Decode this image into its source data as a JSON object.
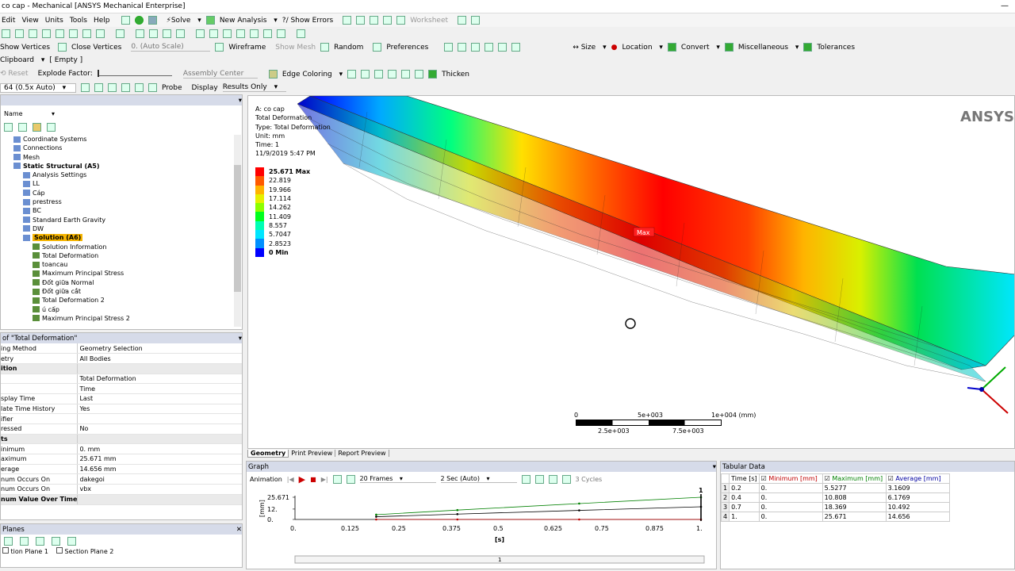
{
  "window": {
    "title": "co cap - Mechanical [ANSYS Mechanical Enterprise]"
  },
  "menu": [
    "Edit",
    "View",
    "Units",
    "Tools",
    "Help"
  ],
  "toolbar1": {
    "solve": "Solve",
    "new_analysis": "New Analysis",
    "show_errors": "Show Errors",
    "worksheet": "Worksheet"
  },
  "toolbar3": {
    "show_vertices": "Show Vertices",
    "close_vertices": "Close Vertices",
    "auto_scale": "0. (Auto Scale)",
    "wireframe": "Wireframe",
    "show_mesh": "Show Mesh",
    "random": "Random",
    "preferences": "Preferences",
    "size": "Size",
    "location": "Location",
    "convert": "Convert",
    "misc": "Miscellaneous",
    "tolerances": "Tolerances"
  },
  "toolbar4": {
    "clipboard": "Clipboard",
    "empty": "[ Empty ]",
    "reset": "Reset",
    "explode_factor": "Explode Factor:",
    "assembly_center": "Assembly Center",
    "edge_coloring": "Edge Coloring",
    "thicken": "Thicken"
  },
  "toolbar5": {
    "scale": "64 (0.5x Auto)",
    "probe": "Probe",
    "display": "Display",
    "results_only": "Results Only"
  },
  "outline": {
    "name_col": "Name",
    "items": [
      {
        "label": "Coordinate Systems",
        "indent": 1
      },
      {
        "label": "Connections",
        "indent": 1
      },
      {
        "label": "Mesh",
        "indent": 1
      },
      {
        "label": "Static Structural (A5)",
        "indent": 1,
        "bold": true
      },
      {
        "label": "Analysis Settings",
        "indent": 2
      },
      {
        "label": "LL",
        "indent": 2
      },
      {
        "label": "Cáp",
        "indent": 2
      },
      {
        "label": "prestress",
        "indent": 2
      },
      {
        "label": "BC",
        "indent": 2
      },
      {
        "label": "Standard Earth Gravity",
        "indent": 2
      },
      {
        "label": "DW",
        "indent": 2
      },
      {
        "label": "Solution (A6)",
        "indent": 2,
        "bold": true,
        "selected": true
      },
      {
        "label": "Solution Information",
        "indent": 3
      },
      {
        "label": "Total Deformation",
        "indent": 3
      },
      {
        "label": "toancau",
        "indent": 3
      },
      {
        "label": "Maximum Principal Stress",
        "indent": 3
      },
      {
        "label": "Đốt giữa Normal",
        "indent": 3
      },
      {
        "label": "Đốt giữa cắt",
        "indent": 3
      },
      {
        "label": "Total Deformation 2",
        "indent": 3
      },
      {
        "label": "ú cấp",
        "indent": 3
      },
      {
        "label": "Maximum Principal Stress 2",
        "indent": 3
      }
    ]
  },
  "details": {
    "title": "of \"Total Deformation\"",
    "rows": [
      {
        "k": "ing Method",
        "v": "Geometry Selection"
      },
      {
        "k": "etry",
        "v": "All Bodies"
      },
      {
        "k": "ition",
        "v": "",
        "sec": true
      },
      {
        "k": "",
        "v": "Total Deformation"
      },
      {
        "k": "",
        "v": "Time"
      },
      {
        "k": "splay Time",
        "v": "Last"
      },
      {
        "k": "late Time History",
        "v": "Yes"
      },
      {
        "k": "ifier",
        "v": ""
      },
      {
        "k": "ressed",
        "v": "No"
      },
      {
        "k": "ts",
        "v": "",
        "sec": true
      },
      {
        "k": "inimum",
        "v": "0. mm"
      },
      {
        "k": "aximum",
        "v": "25.671 mm"
      },
      {
        "k": "erage",
        "v": "14.656 mm"
      },
      {
        "k": "num Occurs On",
        "v": "dakegoi"
      },
      {
        "k": "num Occurs On",
        "v": "vbx"
      },
      {
        "k": "num Value Over Time",
        "v": "",
        "sec": true
      }
    ]
  },
  "planes": {
    "title": "Planes",
    "items": [
      "tion Plane 1",
      "Section Plane 2"
    ]
  },
  "viewport": {
    "info": [
      "A: co cap",
      "Total Deformation",
      "Type: Total Deformation",
      "Unit: mm",
      "Time: 1",
      "11/9/2019 5:47 PM"
    ],
    "logo": "ANSYS",
    "max_tag": "Max",
    "legend": [
      {
        "v": "25.671 Max",
        "c": "#ff0000"
      },
      {
        "v": "22.819",
        "c": "#ff5a00"
      },
      {
        "v": "19.966",
        "c": "#ffb400"
      },
      {
        "v": "17.114",
        "c": "#e6f000"
      },
      {
        "v": "14.262",
        "c": "#8cff00"
      },
      {
        "v": "11.409",
        "c": "#00ff1e"
      },
      {
        "v": "8.557",
        "c": "#00ffb4"
      },
      {
        "v": "5.7047",
        "c": "#00e6ff"
      },
      {
        "v": "2.8523",
        "c": "#0090ff"
      },
      {
        "v": "0 Min",
        "c": "#0000ff"
      }
    ],
    "scale": {
      "a": "0",
      "b": "5e+003",
      "c": "1e+004 (mm)",
      "d": "2.5e+003",
      "e": "7.5e+003"
    },
    "tabs": [
      "Geometry",
      "Print Preview",
      "Report Preview"
    ]
  },
  "graph": {
    "title": "Graph",
    "animation": "Animation",
    "frames": "20 Frames",
    "duration": "2 Sec (Auto)",
    "cycles": "3 Cycles",
    "ylabel": "[mm]",
    "xlabel": "[s]",
    "marker": "1",
    "timeline": "1"
  },
  "chart_data": {
    "type": "line",
    "x": [
      0.2,
      0.4,
      0.7,
      1.0
    ],
    "series": [
      {
        "name": "Minimum [mm]",
        "values": [
          0,
          0,
          0,
          0
        ],
        "color": "#c00000"
      },
      {
        "name": "Maximum [mm]",
        "values": [
          5.5277,
          10.808,
          18.369,
          25.671
        ],
        "color": "#008000"
      },
      {
        "name": "Average [mm]",
        "values": [
          3.1609,
          6.1769,
          10.492,
          14.656
        ],
        "color": "#000000"
      }
    ],
    "xticks": [
      "0.",
      "0.125",
      "0.25",
      "0.375",
      "0.5",
      "0.625",
      "0.75",
      "0.875",
      "1."
    ],
    "yticks": [
      "25.671",
      "12.",
      "0."
    ],
    "xlim": [
      0,
      1
    ],
    "ylim": [
      0,
      25.671
    ]
  },
  "tabular": {
    "title": "Tabular Data",
    "headers": [
      "Time [s]",
      "Minimum [mm]",
      "Maximum [mm]",
      "Average [mm]"
    ],
    "rows": [
      [
        "1",
        "0.2",
        "0.",
        "5.5277",
        "3.1609"
      ],
      [
        "2",
        "0.4",
        "0.",
        "10.808",
        "6.1769"
      ],
      [
        "3",
        "0.7",
        "0.",
        "18.369",
        "10.492"
      ],
      [
        "4",
        "1.",
        "0.",
        "25.671",
        "14.656"
      ]
    ]
  }
}
